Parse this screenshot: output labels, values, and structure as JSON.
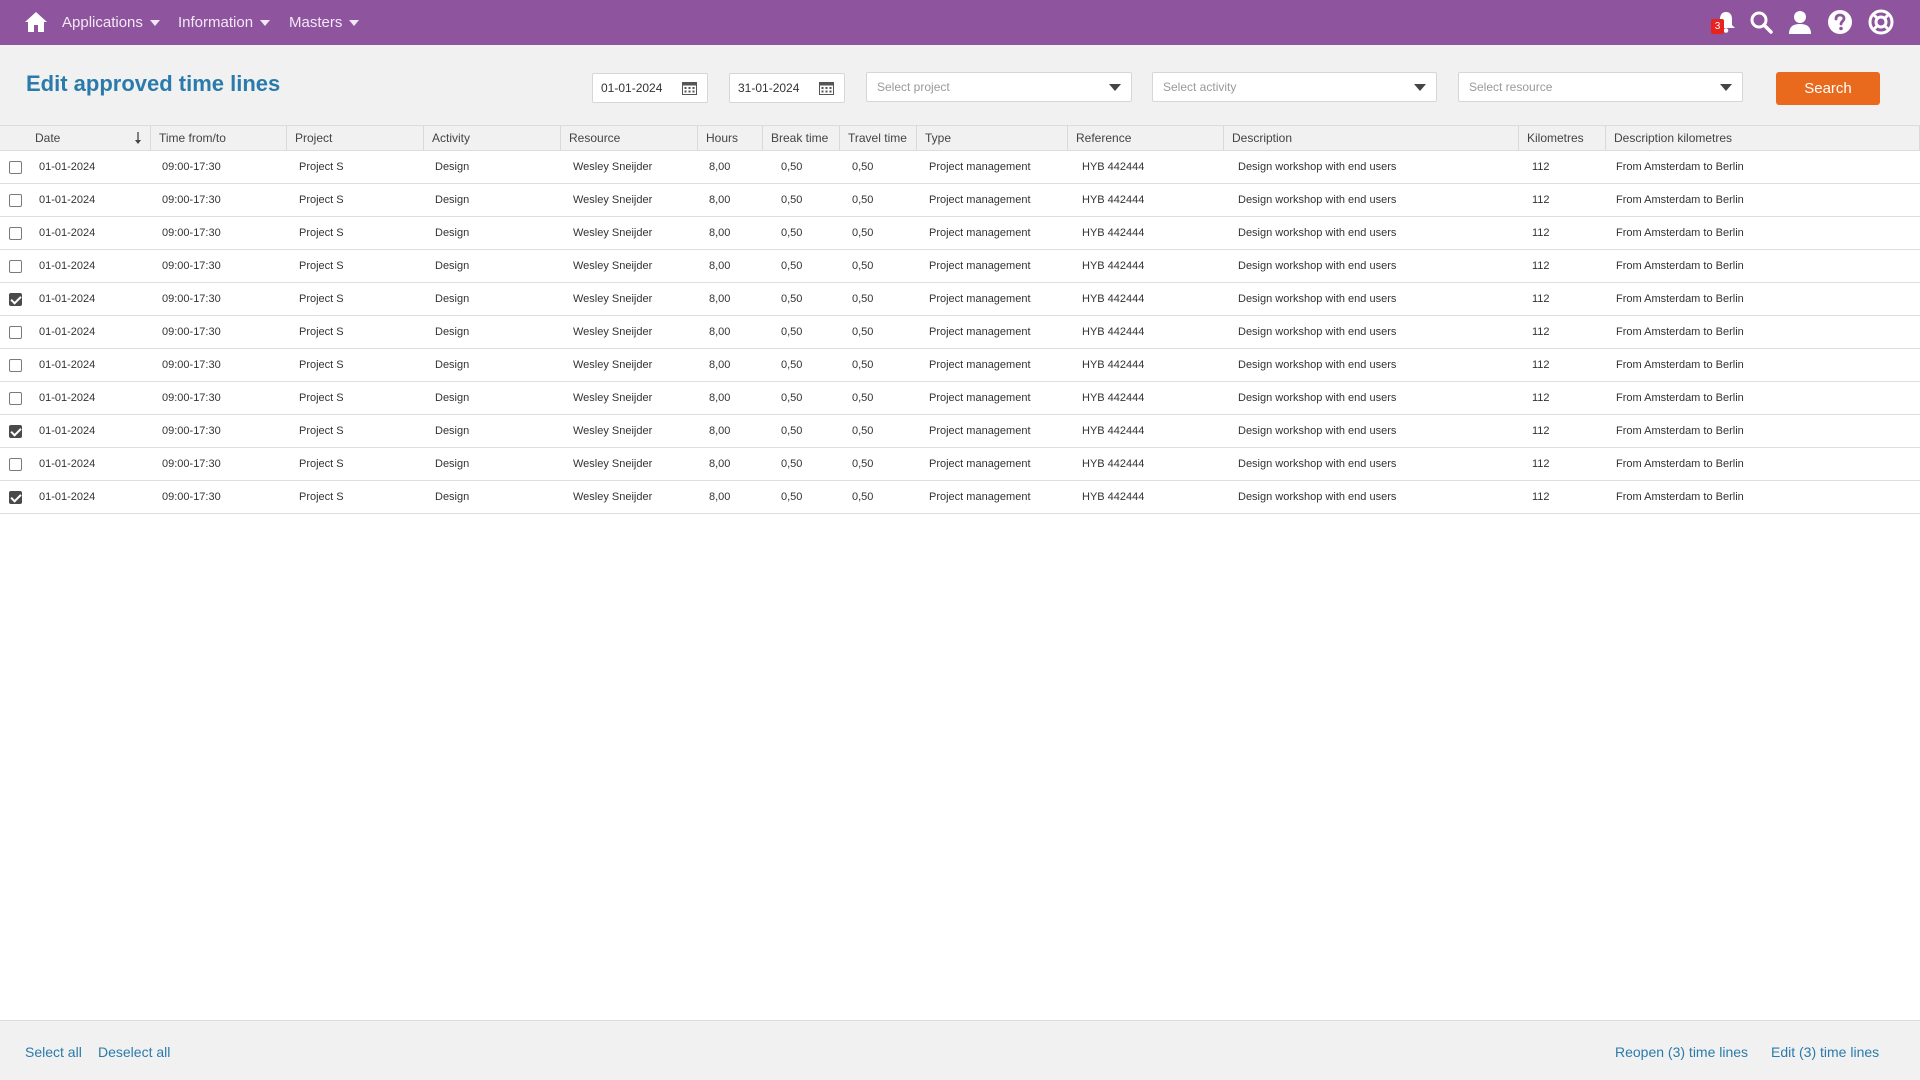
{
  "nav": {
    "menus": [
      {
        "label": "Applications"
      },
      {
        "label": "Information"
      },
      {
        "label": "Masters"
      }
    ],
    "notification_count": "3",
    "icons": [
      "home-icon",
      "bell-icon",
      "search-icon",
      "user-icon",
      "help-icon",
      "support-icon"
    ],
    "color": "#8e549e"
  },
  "toolbar": {
    "title": "Edit approved time lines",
    "date_from": "01-01-2024",
    "date_to": "31-01-2024",
    "project_placeholder": "Select project",
    "activity_placeholder": "Select activity",
    "resource_placeholder": "Select resource",
    "search_label": "Search",
    "search_color": "#ea6a1d"
  },
  "table": {
    "columns": [
      "Date",
      "Time from/to",
      "Project",
      "Activity",
      "Resource",
      "Hours",
      "Break time",
      "Travel time",
      "Type",
      "Reference",
      "Description",
      "Kilometres",
      "Description kilometres"
    ],
    "sort_column": "Date",
    "rows": [
      {
        "checked": false,
        "cells": [
          "01-01-2024",
          "09:00-17:30",
          "Project S",
          "Design",
          "Wesley Sneijder",
          "8,00",
          "0,50",
          "0,50",
          "Project management",
          "HYB 442444",
          "Design workshop with end users",
          "112",
          "From Amsterdam to Berlin"
        ]
      },
      {
        "checked": false,
        "cells": [
          "01-01-2024",
          "09:00-17:30",
          "Project S",
          "Design",
          "Wesley Sneijder",
          "8,00",
          "0,50",
          "0,50",
          "Project management",
          "HYB 442444",
          "Design workshop with end users",
          "112",
          "From Amsterdam to Berlin"
        ]
      },
      {
        "checked": false,
        "cells": [
          "01-01-2024",
          "09:00-17:30",
          "Project S",
          "Design",
          "Wesley Sneijder",
          "8,00",
          "0,50",
          "0,50",
          "Project management",
          "HYB 442444",
          "Design workshop with end users",
          "112",
          "From Amsterdam to Berlin"
        ]
      },
      {
        "checked": false,
        "cells": [
          "01-01-2024",
          "09:00-17:30",
          "Project S",
          "Design",
          "Wesley Sneijder",
          "8,00",
          "0,50",
          "0,50",
          "Project management",
          "HYB 442444",
          "Design workshop with end users",
          "112",
          "From Amsterdam to Berlin"
        ]
      },
      {
        "checked": true,
        "cells": [
          "01-01-2024",
          "09:00-17:30",
          "Project S",
          "Design",
          "Wesley Sneijder",
          "8,00",
          "0,50",
          "0,50",
          "Project management",
          "HYB 442444",
          "Design workshop with end users",
          "112",
          "From Amsterdam to Berlin"
        ]
      },
      {
        "checked": false,
        "cells": [
          "01-01-2024",
          "09:00-17:30",
          "Project S",
          "Design",
          "Wesley Sneijder",
          "8,00",
          "0,50",
          "0,50",
          "Project management",
          "HYB 442444",
          "Design workshop with end users",
          "112",
          "From Amsterdam to Berlin"
        ]
      },
      {
        "checked": false,
        "cells": [
          "01-01-2024",
          "09:00-17:30",
          "Project S",
          "Design",
          "Wesley Sneijder",
          "8,00",
          "0,50",
          "0,50",
          "Project management",
          "HYB 442444",
          "Design workshop with end users",
          "112",
          "From Amsterdam to Berlin"
        ]
      },
      {
        "checked": false,
        "cells": [
          "01-01-2024",
          "09:00-17:30",
          "Project S",
          "Design",
          "Wesley Sneijder",
          "8,00",
          "0,50",
          "0,50",
          "Project management",
          "HYB 442444",
          "Design workshop with end users",
          "112",
          "From Amsterdam to Berlin"
        ]
      },
      {
        "checked": true,
        "cells": [
          "01-01-2024",
          "09:00-17:30",
          "Project S",
          "Design",
          "Wesley Sneijder",
          "8,00",
          "0,50",
          "0,50",
          "Project management",
          "HYB 442444",
          "Design workshop with end users",
          "112",
          "From Amsterdam to Berlin"
        ]
      },
      {
        "checked": false,
        "cells": [
          "01-01-2024",
          "09:00-17:30",
          "Project S",
          "Design",
          "Wesley Sneijder",
          "8,00",
          "0,50",
          "0,50",
          "Project management",
          "HYB 442444",
          "Design workshop with end users",
          "112",
          "From Amsterdam to Berlin"
        ]
      },
      {
        "checked": true,
        "cells": [
          "01-01-2024",
          "09:00-17:30",
          "Project S",
          "Design",
          "Wesley Sneijder",
          "8,00",
          "0,50",
          "0,50",
          "Project management",
          "HYB 442444",
          "Design workshop with end users",
          "112",
          "From Amsterdam to Berlin"
        ]
      }
    ]
  },
  "footer": {
    "select_all": "Select all",
    "deselect_all": "Deselect all",
    "reopen": "Reopen (3) time lines",
    "edit": "Edit (3) time lines",
    "link_color": "#2a7bab"
  }
}
